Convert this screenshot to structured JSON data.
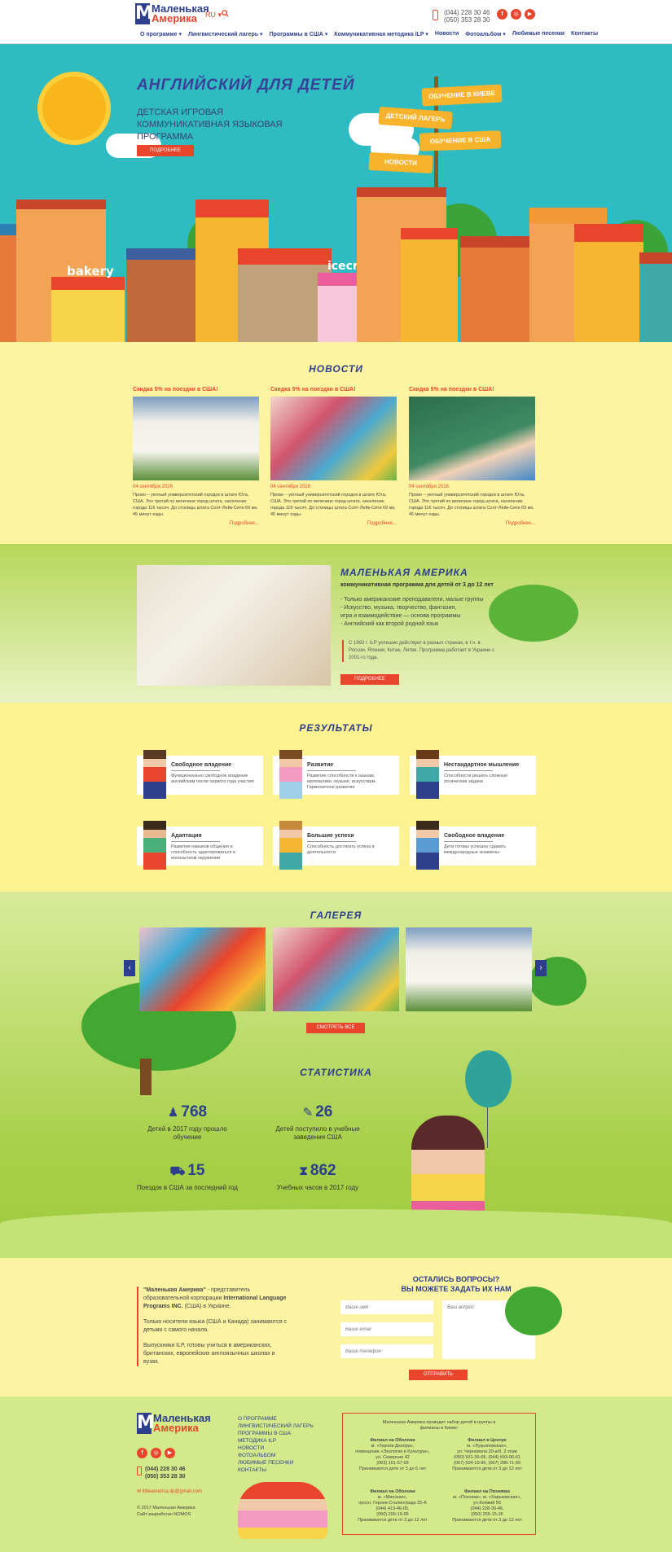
{
  "header": {
    "logo_line1": "Маленькая",
    "logo_line2": "Америка",
    "lang": "RU ▾",
    "phones": [
      "(044) 228 30 46",
      "(050) 353 28 30"
    ],
    "nav": [
      "О программе ▾",
      "Лингвистический лагерь ▾",
      "Программы в США ▾",
      "Коммуникативная методика ILP ▾",
      "Новости",
      "Фотоальбом ▾",
      "Любимые песенки",
      "Контакты"
    ]
  },
  "hero": {
    "title": "АНГЛИЙСКИЙ ДЛЯ ДЕТЕЙ",
    "subtitle": "ДЕТСКАЯ ИГРОВАЯ КОММУНИКАТИВНАЯ ЯЗЫКОВАЯ ПРОГРАММА",
    "button": "ПОДРОБНЕЕ",
    "signs": [
      "ОБУЧЕНИЕ В КИЕВЕ",
      "ДЕТСКИЙ ЛАГЕРЬ",
      "ОБУЧЕНИЕ В США",
      "НОВОСТИ"
    ],
    "shops": [
      "bakery",
      "icecream"
    ]
  },
  "news": {
    "title": "НОВОСТИ",
    "items": [
      {
        "caption": "Скидка 5% на поездки в США!",
        "date": "04 сентября 2016",
        "text": "Прово – уютный университетский городок в штате Юта, США. Это третий по величине город штата, население города 116 тысяч. До столицы штата Солт-Лейк-Сити 69 км, 45 минут езды.",
        "more": "Подробнее..."
      },
      {
        "caption": "Скидка 5% на поездки в США!",
        "date": "04 сентября 2016",
        "text": "Прово – уютный университетский городок в штате Юта, США. Это третий по величине город штата, население города 116 тысяч. До столицы штата Солт-Лейк-Сити 69 км, 45 минут езды.",
        "more": "Подробнее..."
      },
      {
        "caption": "Скидка 5% на поездки в США!",
        "date": "04 сентября 2016",
        "text": "Прово – уютный университетский городок в штате Юта, США. Это третий по величине город штата, население города 116 тысяч. До столицы штата Солт-Лейк-Сити 69 км, 45 минут езды.",
        "more": "Подробнее..."
      }
    ]
  },
  "about": {
    "title": "МАЛЕНЬКАЯ АМЕРИКА",
    "subtitle": "коммуникативная программа для детей от 3 до 12 лет",
    "list": [
      "- Только американские преподаватели, малые группы",
      "- Искусство, музыка, творчество, фантазия,",
      "  игра и взаимодействие — основа программы",
      "- Английский как второй родной язык"
    ],
    "quote": "С 1992 г. ILP успешно действует в разных странах, в т.ч. в России, Японии, Китае, Литве. Программа работает в Украине с 2001-го года.",
    "button": "ПОДРОБНЕЕ"
  },
  "results": {
    "title": "РЕЗУЛЬТАТЫ",
    "items": [
      {
        "head": "Свободное владение",
        "text": "Функционально свободное владение английским после первого года участия"
      },
      {
        "head": "Развитие",
        "text": "Развитие способности к языкам, математике, музыке, искусствам. Гармоничное развитие"
      },
      {
        "head": "Нестандартное мышление",
        "text": "Способности решать сложные логические задачи"
      },
      {
        "head": "Адаптация",
        "text": "Развитие навыков общения и способность адаптироваться в иноязычном окружении"
      },
      {
        "head": "Большие успехи",
        "text": "Способность достигать успеха в деятельности"
      },
      {
        "head": "Свободное владение",
        "text": "Дети готовы успешно сдавать международные экзамены"
      }
    ]
  },
  "gallery": {
    "title": "ГАЛЕРЕЯ",
    "button": "СМОТРЕТЬ ВСЕ"
  },
  "stats": {
    "title": "СТАТИСТИКА",
    "items": [
      {
        "icon": "person-icon",
        "value": "768",
        "label": "Детей в 2017 году прошло обучение"
      },
      {
        "icon": "graduate-icon",
        "value": "26",
        "label": "Детей поступило в учебные заведения США"
      },
      {
        "icon": "bus-icon",
        "value": "15",
        "label": "Поездок в США за последний год"
      },
      {
        "icon": "hourglass-icon",
        "value": "862",
        "label": "Учебных часов в 2017 году"
      }
    ]
  },
  "contact": {
    "para1_bold": "\"Маленькая Америка\"",
    "para1_rest": " - представитель образовательной корпорации ",
    "para1_bold2": "International Language Programs INC.",
    "para1_end": " (США) в Украине.",
    "para2": "Только носители языка (США и Канада) занимаются с детьми с самого начала.",
    "para3": "Выпускники ILP, готовы учиться в американских, британских, европейских англоязычных школах и вузах.",
    "title1": "ОСТАЛИСЬ ВОПРОСЫ?",
    "title2": "ВЫ МОЖЕТЕ ЗАДАТЬ ИХ НАМ",
    "name_ph": "Ваше имя",
    "email_ph": "Ваше email",
    "phone_ph": "Ваше телефон",
    "question_ph": "Ваш вопрос",
    "submit": "ОТПРАВИТЬ"
  },
  "footer": {
    "links": [
      "О ПРОГРАММЕ",
      "ЛИНГВИСТИЧЕСКИЙ ЛАГЕРЬ",
      "ПРОГРАММЫ В США",
      "МЕТОДИКА ILP",
      "НОВОСТИ",
      "ФОТОАЛЬБОМ",
      "ЛЮБИМЫЕ ПЕСЕНКИ",
      "КОНТАКТЫ"
    ],
    "phones": [
      "(044) 228 30 46",
      "(050) 353 28 30"
    ],
    "email": "littleamerica.ilp@gmail.com",
    "copy1": "© 2017 Маленькая Америка",
    "copy2": "Сайт-разработан NOMOS",
    "box_header": "Маленькая Америка проводит набор детей в группы в филиалы в Киеве:",
    "branches": [
      {
        "name": "Филиал на Оболони",
        "lines": [
          "м. «Героев Днепра»,",
          "помещение «Экология и Культура»,",
          "ул. Северная 42",
          "(063) 151-57-09",
          "Принимаются дети от 3 до 6 лет"
        ]
      },
      {
        "name": "Филиал в Центре",
        "lines": [
          "м. «Лукьяновская»,",
          "ул. Черновола 20-а/б, 2 этаж",
          "(050) 921-36-65, (044) 593-06-61",
          "(067) 504-10-95, (067) 288-71-69",
          "Принимаются дети от 3 до 12 лет"
        ]
      },
      {
        "name": "Филиал на Оболони",
        "lines": [
          "м. «Минская»,",
          "просп. Героев Сталинграда 25-А",
          "(044) 413-46-05,",
          "(050) 209-19-05",
          "Принимаются дети от 3 до 12 лет"
        ]
      },
      {
        "name": "Филиал на Позняках",
        "lines": [
          "м. «Позняки», м. «Харьковская»,",
          "ул.Княжий 56",
          "(044) 228-30-46,",
          "(050) 266-15-26",
          "Принимаются дети от 3 до 12 лет"
        ]
      }
    ]
  }
}
